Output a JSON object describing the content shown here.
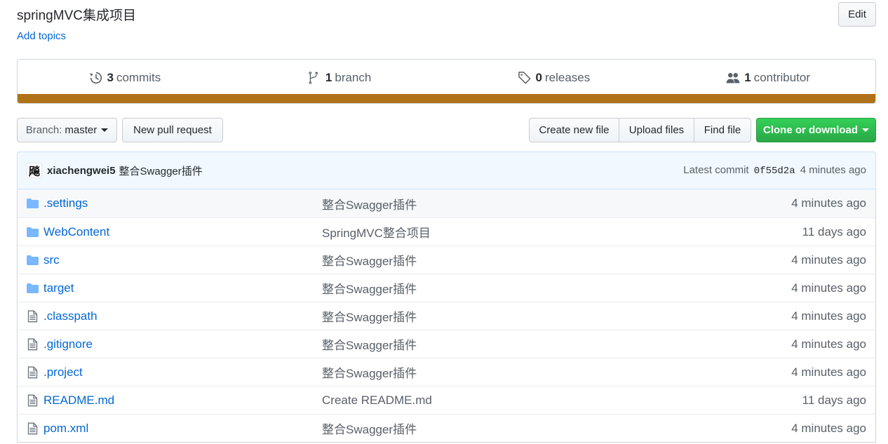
{
  "repo": {
    "description": "springMVC集成项目",
    "add_topics": "Add topics",
    "edit_label": "Edit"
  },
  "summary": {
    "commits": {
      "num": "3",
      "label": "commits",
      "icon": "history-icon"
    },
    "branches": {
      "num": "1",
      "label": "branch",
      "icon": "git-branch-icon"
    },
    "releases": {
      "num": "0",
      "label": "releases",
      "icon": "tag-icon"
    },
    "contributors": {
      "num": "1",
      "label": "contributor",
      "icon": "people-icon"
    },
    "language_bar_color": "#b07219"
  },
  "toolbar": {
    "branch_label": "Branch:",
    "branch_value": "master",
    "new_pull_request": "New pull request",
    "create_new_file": "Create new file",
    "upload_files": "Upload files",
    "find_file": "Find file",
    "clone_or_download": "Clone or download"
  },
  "commit": {
    "author": "xiachengwei5",
    "message": "整合Swagger插件",
    "latest_label": "Latest commit",
    "sha": "0f55d2a",
    "age": "4 minutes ago",
    "avatar_glyph": "飚"
  },
  "files": [
    {
      "type": "dir",
      "name": ".settings",
      "message": "整合Swagger插件",
      "age": "4 minutes ago"
    },
    {
      "type": "dir",
      "name": "WebContent",
      "message": "SpringMVC整合项目",
      "age": "11 days ago"
    },
    {
      "type": "dir",
      "name": "src",
      "message": "整合Swagger插件",
      "age": "4 minutes ago"
    },
    {
      "type": "dir",
      "name": "target",
      "message": "整合Swagger插件",
      "age": "4 minutes ago"
    },
    {
      "type": "file",
      "name": ".classpath",
      "message": "整合Swagger插件",
      "age": "4 minutes ago"
    },
    {
      "type": "file",
      "name": ".gitignore",
      "message": "整合Swagger插件",
      "age": "4 minutes ago"
    },
    {
      "type": "file",
      "name": ".project",
      "message": "整合Swagger插件",
      "age": "4 minutes ago"
    },
    {
      "type": "file",
      "name": "README.md",
      "message": "Create README.md",
      "age": "11 days ago"
    },
    {
      "type": "file",
      "name": "pom.xml",
      "message": "整合Swagger插件",
      "age": "4 minutes ago"
    }
  ]
}
